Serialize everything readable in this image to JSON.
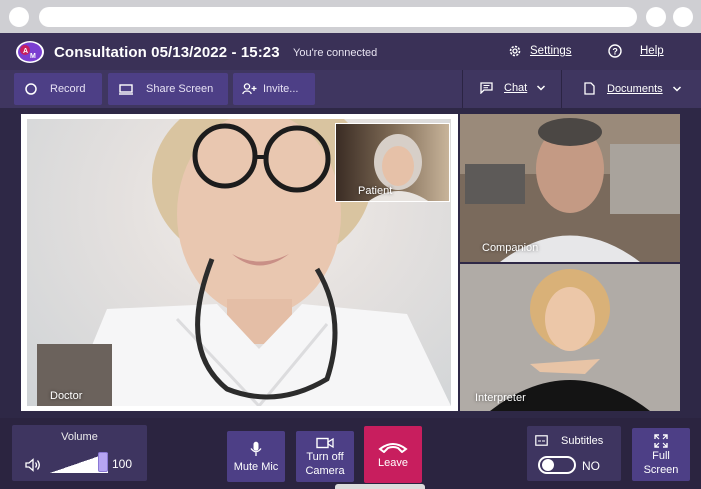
{
  "header": {
    "title": "Consultation 05/13/2022 - 15:23",
    "status": "You're connected",
    "settings_label": "Settings",
    "help_label": "Help"
  },
  "toolbar": {
    "record_label": "Record",
    "share_label": "Share Screen",
    "invite_label": "Invite...",
    "chat_label": "Chat",
    "documents_label": "Documents"
  },
  "tiles": {
    "doctor": "Doctor",
    "patient": "Patient",
    "companion": "Companion",
    "interpreter": "Interpreter"
  },
  "controls": {
    "volume_label": "Volume",
    "volume_value": "100",
    "volume_level": 1.0,
    "mute_label": "Mute Mic",
    "camera_label_line1": "Turn off",
    "camera_label_line2": "Camera",
    "leave_label": "Leave",
    "subtitles_label": "Subtitles",
    "subtitles_state": "NO",
    "fullscreen_line1": "Full",
    "fullscreen_line2": "Screen"
  },
  "colors": {
    "accent": "#4d3f86",
    "leave": "#c81e5e",
    "header": "#3a3157"
  },
  "icons": [
    "settings-icon",
    "help-icon",
    "record-icon",
    "share-screen-icon",
    "invite-icon",
    "chat-icon",
    "documents-icon",
    "volume-icon",
    "mic-icon",
    "camera-icon",
    "phone-hangup-icon",
    "subtitles-icon",
    "fullscreen-icon"
  ]
}
